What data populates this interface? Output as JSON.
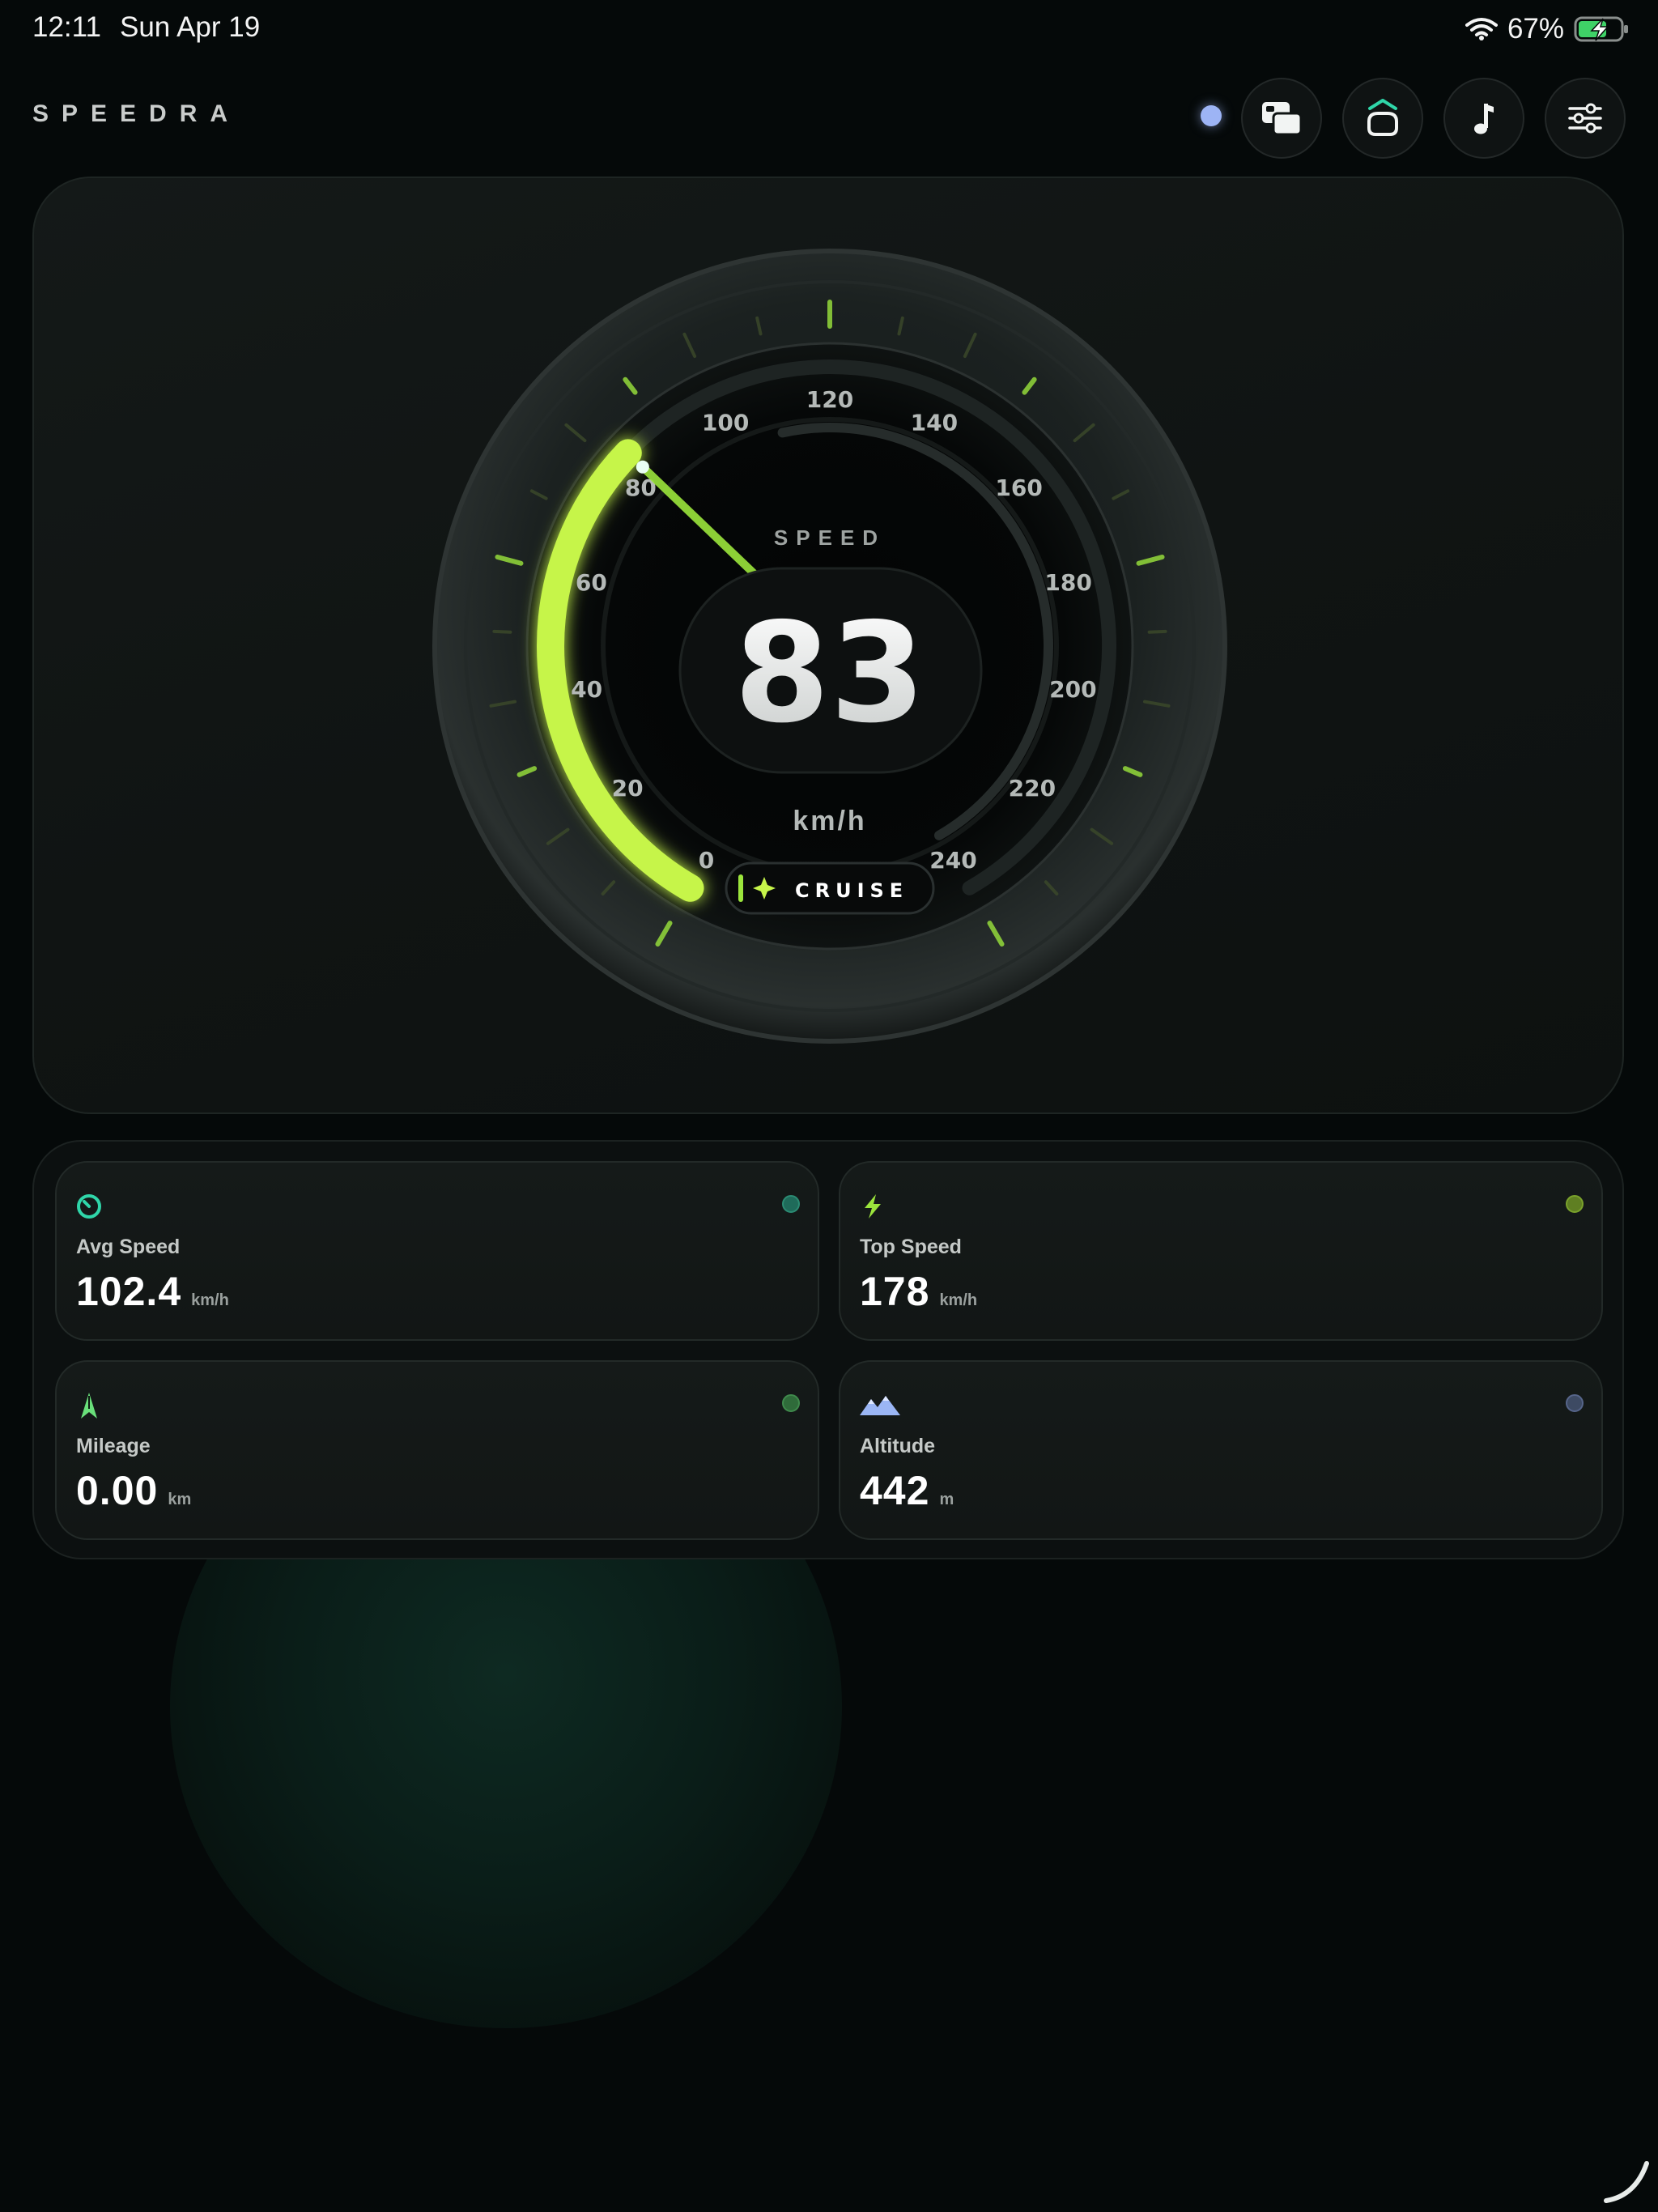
{
  "status_bar": {
    "time": "12:11",
    "date": "Sun Apr 19",
    "battery": "67%"
  },
  "header": {
    "brand": "SPEEDRA",
    "buttons": [
      {
        "name": "display-mode-button",
        "icon": "screens-icon"
      },
      {
        "name": "car-view-button",
        "icon": "car-icon"
      },
      {
        "name": "music-button",
        "icon": "music-note-icon"
      },
      {
        "name": "settings-button",
        "icon": "sliders-icon"
      }
    ]
  },
  "gauge": {
    "caption": "SPEED",
    "speed": "83",
    "unit": "km/h",
    "mode": "CRUISE",
    "ticks": [
      "0",
      "20",
      "40",
      "60",
      "80",
      "100",
      "120",
      "140",
      "160",
      "180",
      "200",
      "220",
      "240"
    ],
    "min": 0,
    "max": 240,
    "value": 83,
    "accent": "#c6f54a"
  },
  "stats": [
    {
      "label": "Avg Speed",
      "value": "102.4",
      "unit": "km/h",
      "icon": "gauge-icon",
      "icon_color": "#2fd6a9",
      "dot_color": "#1f6b5a"
    },
    {
      "label": "Top Speed",
      "value": "178",
      "unit": "km/h",
      "icon": "lightning-icon",
      "icon_color": "#9be53c",
      "dot_color": "#5f7f22"
    },
    {
      "label": "Mileage",
      "value": "0.00",
      "unit": "km",
      "icon": "road-icon",
      "icon_color": "#69e07a",
      "dot_color": "#2f6b3a"
    },
    {
      "label": "Altitude",
      "value": "442",
      "unit": "m",
      "icon": "mountain-icon",
      "icon_color": "#9bb6f5",
      "dot_color": "#3d4a63"
    }
  ]
}
